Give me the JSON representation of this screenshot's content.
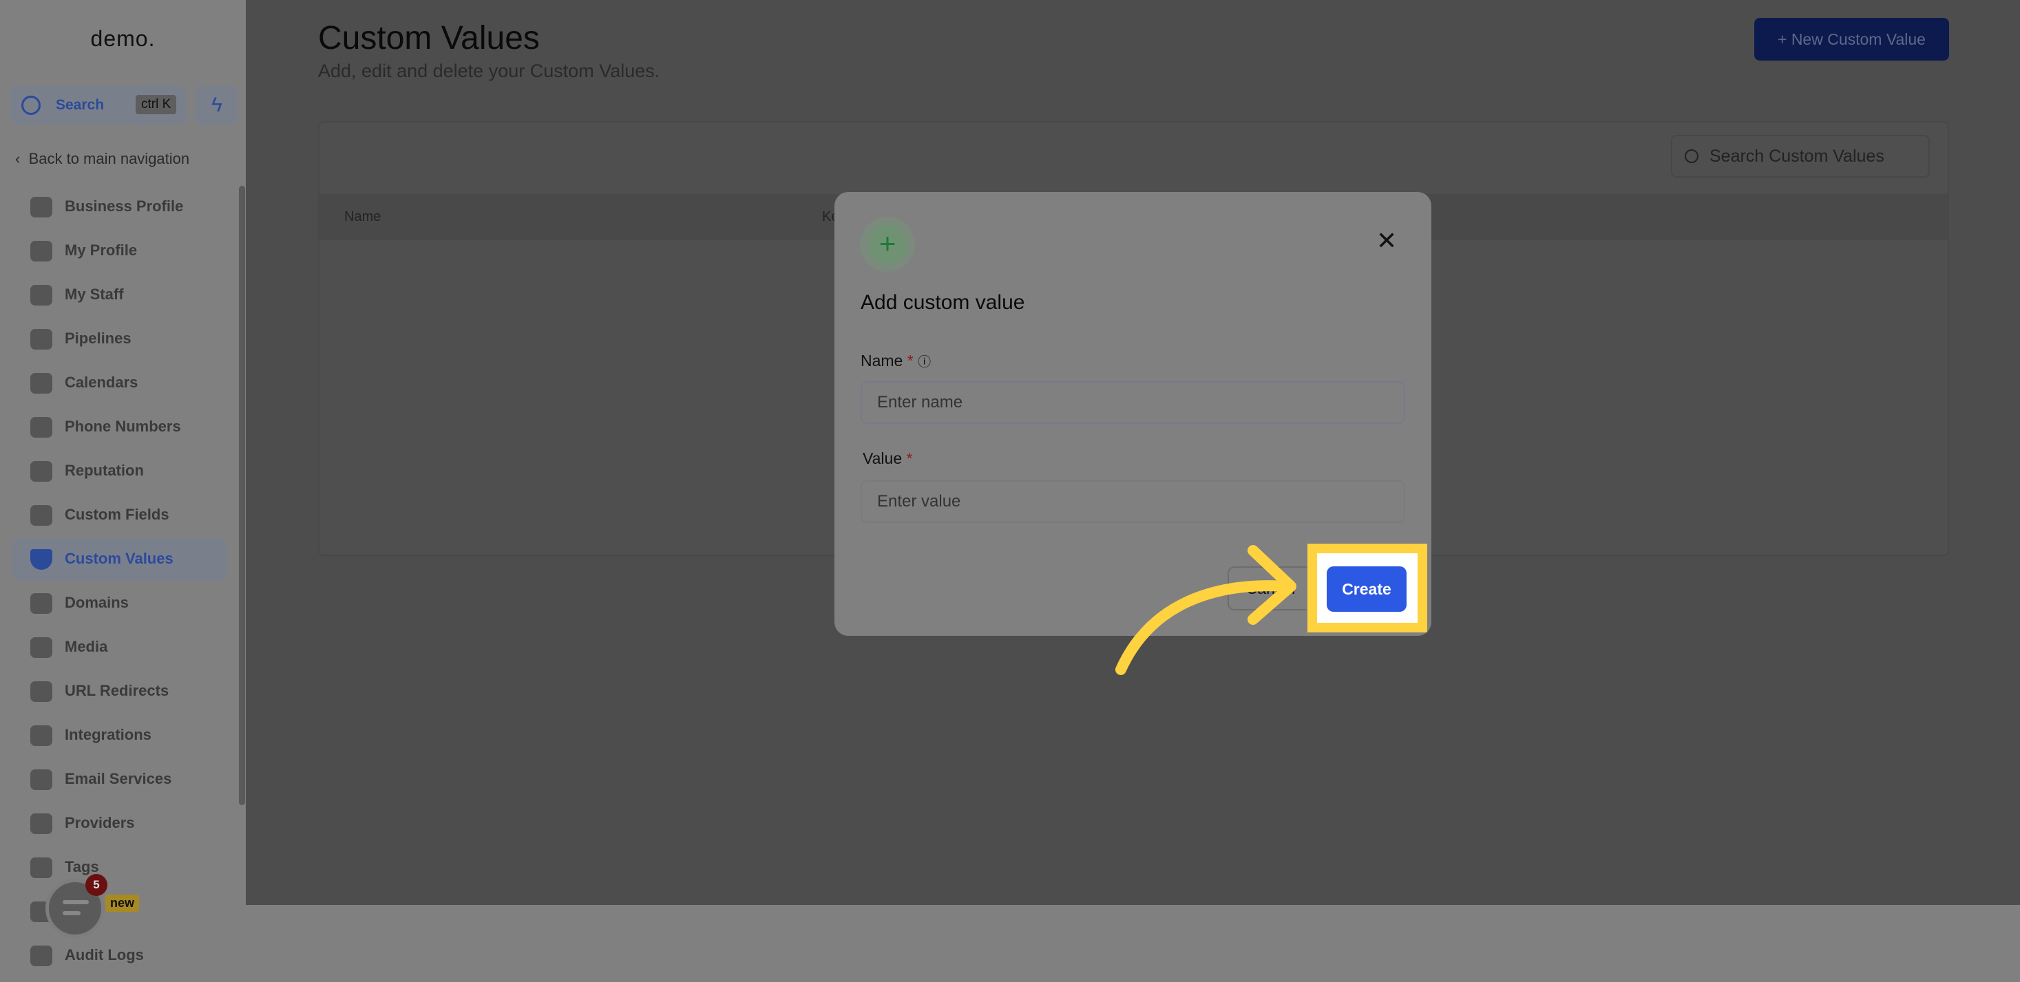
{
  "sidebar": {
    "logo": "demo.",
    "search_label": "Search",
    "search_shortcut": "ctrl K",
    "back_label": "Back to main navigation",
    "items": [
      {
        "label": "Business Profile",
        "icon": "briefcase-icon"
      },
      {
        "label": "My Profile",
        "icon": "user-circle-icon"
      },
      {
        "label": "My Staff",
        "icon": "user-icon"
      },
      {
        "label": "Pipelines",
        "icon": "filter-icon"
      },
      {
        "label": "Calendars",
        "icon": "calendar-icon"
      },
      {
        "label": "Phone Numbers",
        "icon": "phone-icon"
      },
      {
        "label": "Reputation",
        "icon": "star-icon"
      },
      {
        "label": "Custom Fields",
        "icon": "field-icon"
      },
      {
        "label": "Custom Values",
        "icon": "gem-icon",
        "active": true
      },
      {
        "label": "Domains",
        "icon": "globe-icon"
      },
      {
        "label": "Media",
        "icon": "video-icon"
      },
      {
        "label": "URL Redirects",
        "icon": "redirect-icon"
      },
      {
        "label": "Integrations",
        "icon": "integration-icon"
      },
      {
        "label": "Email Services",
        "icon": "mail-icon"
      },
      {
        "label": "Providers",
        "icon": "clipboard-icon"
      },
      {
        "label": "Tags",
        "icon": "tag-icon"
      },
      {
        "label": "",
        "icon": "lab-icon"
      },
      {
        "label": "Audit Logs",
        "icon": "chart-icon"
      }
    ],
    "new_badge": "new",
    "chat_badge_count": "5"
  },
  "page": {
    "title": "Custom Values",
    "subtitle": "Add, edit and delete your Custom Values.",
    "new_button": "+ New Custom Value",
    "search_placeholder": "Search Custom Values",
    "columns": [
      "Name",
      "Ke"
    ]
  },
  "modal": {
    "title": "Add custom value",
    "name_label": "Name",
    "name_placeholder": "Enter name",
    "value_label": "Value",
    "value_placeholder": "Enter value",
    "required_mark": "*",
    "cancel": "Cancel",
    "create": "Create"
  },
  "colors": {
    "accent": "#2b59e3",
    "highlight": "#ffd23f",
    "overlay": "#4d4d4d"
  }
}
